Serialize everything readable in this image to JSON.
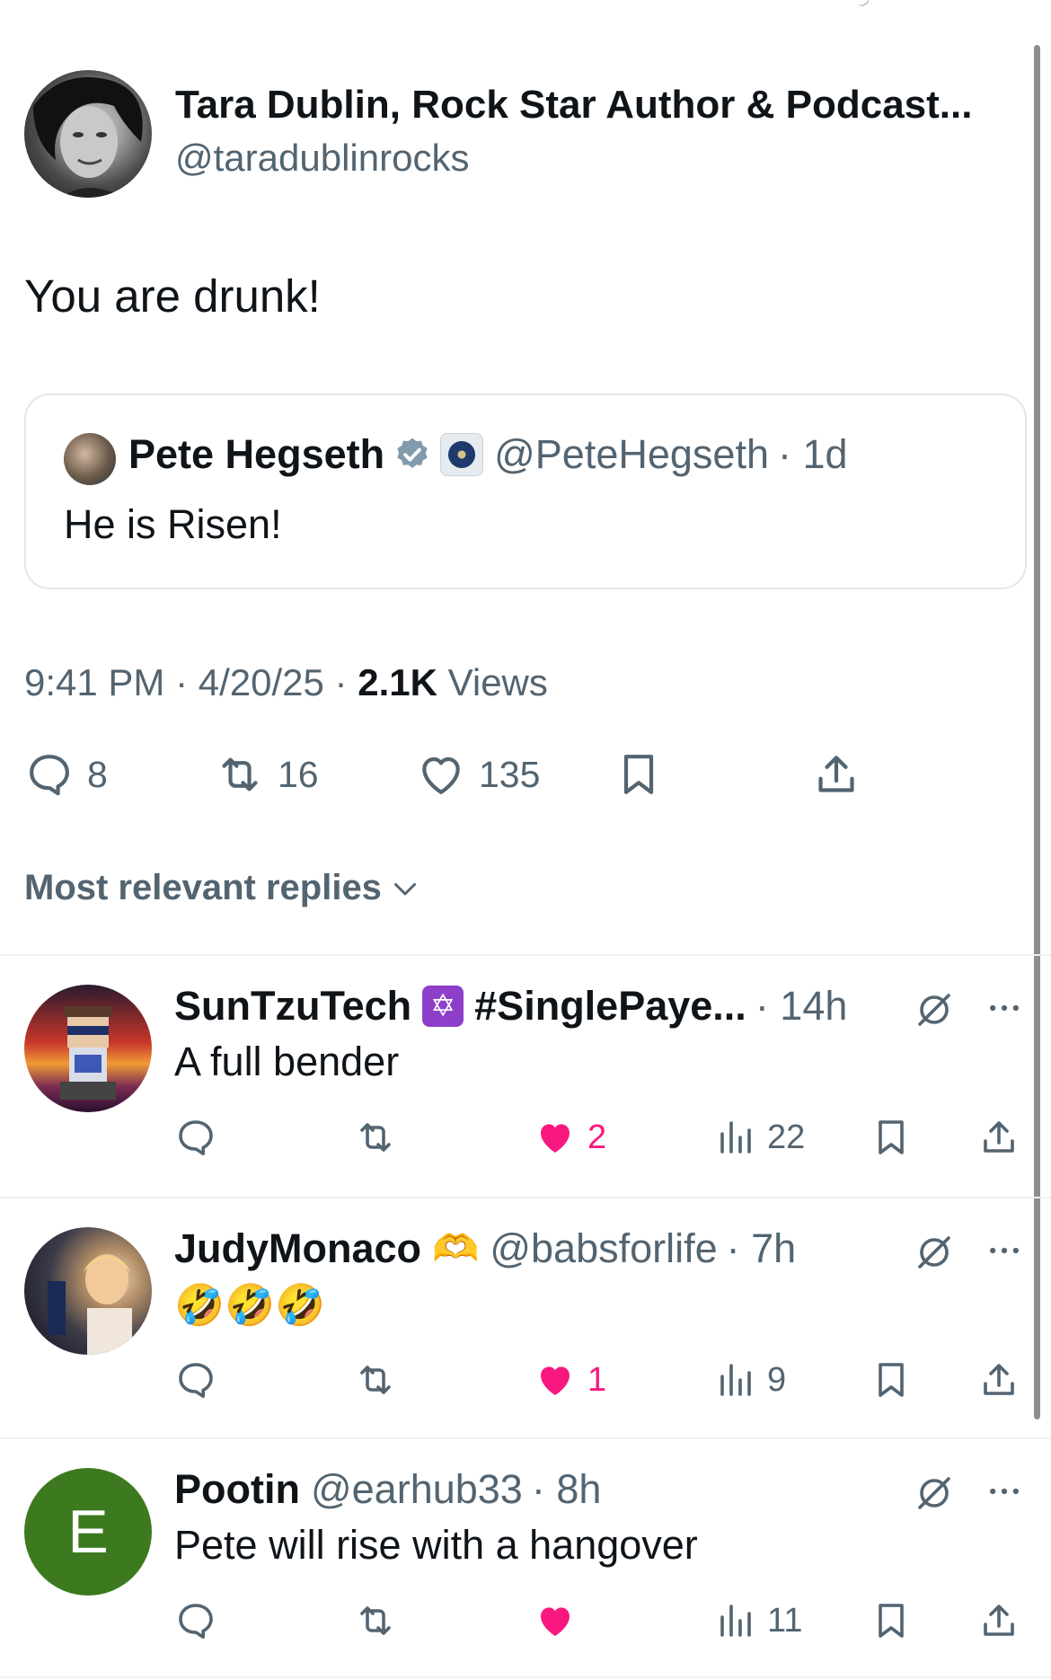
{
  "main_tweet": {
    "author_name": "Tara Dublin, Rock Star Author & Podcast...",
    "author_handle": "@taradublinrocks",
    "text": "You are drunk!",
    "quoted": {
      "author_name": "Pete Hegseth",
      "author_handle": "@PeteHegseth",
      "time": "· 1d",
      "text": "He is Risen!",
      "icons": [
        "verified-badge-icon",
        "affiliation-badge-icon"
      ]
    },
    "time": "9:41 PM",
    "date": "· 4/20/25 ·",
    "views_count": "2.1K",
    "views_label": "Views",
    "stats": {
      "replies": "8",
      "reposts": "16",
      "likes": "135"
    }
  },
  "sort_label": "Most relevant replies",
  "replies": [
    {
      "name": "SunTzuTech",
      "emoji": "✡️",
      "tag": "#SinglePaye...",
      "handle": "",
      "time": "· 14h",
      "text": "A full bender",
      "likes": "2",
      "views": "22",
      "liked": true
    },
    {
      "name": "JudyMonaco",
      "emoji": "🫶",
      "tag": "",
      "handle": "@babsforlife",
      "time": "· 7h",
      "text": "🤣🤣🤣",
      "likes": "1",
      "views": "9",
      "liked": true
    },
    {
      "name": "Pootin",
      "emoji": "",
      "tag": "",
      "handle": "@earhub33",
      "time": "· 8h",
      "text": "Pete will rise with a hangover",
      "likes": "",
      "views": "11",
      "liked": true,
      "avatar_letter": "E"
    }
  ],
  "colors": {
    "like": "#f91880",
    "secondary": "#536471",
    "verified": "#829aab",
    "pootin_avatar": "#3d7a1f"
  }
}
